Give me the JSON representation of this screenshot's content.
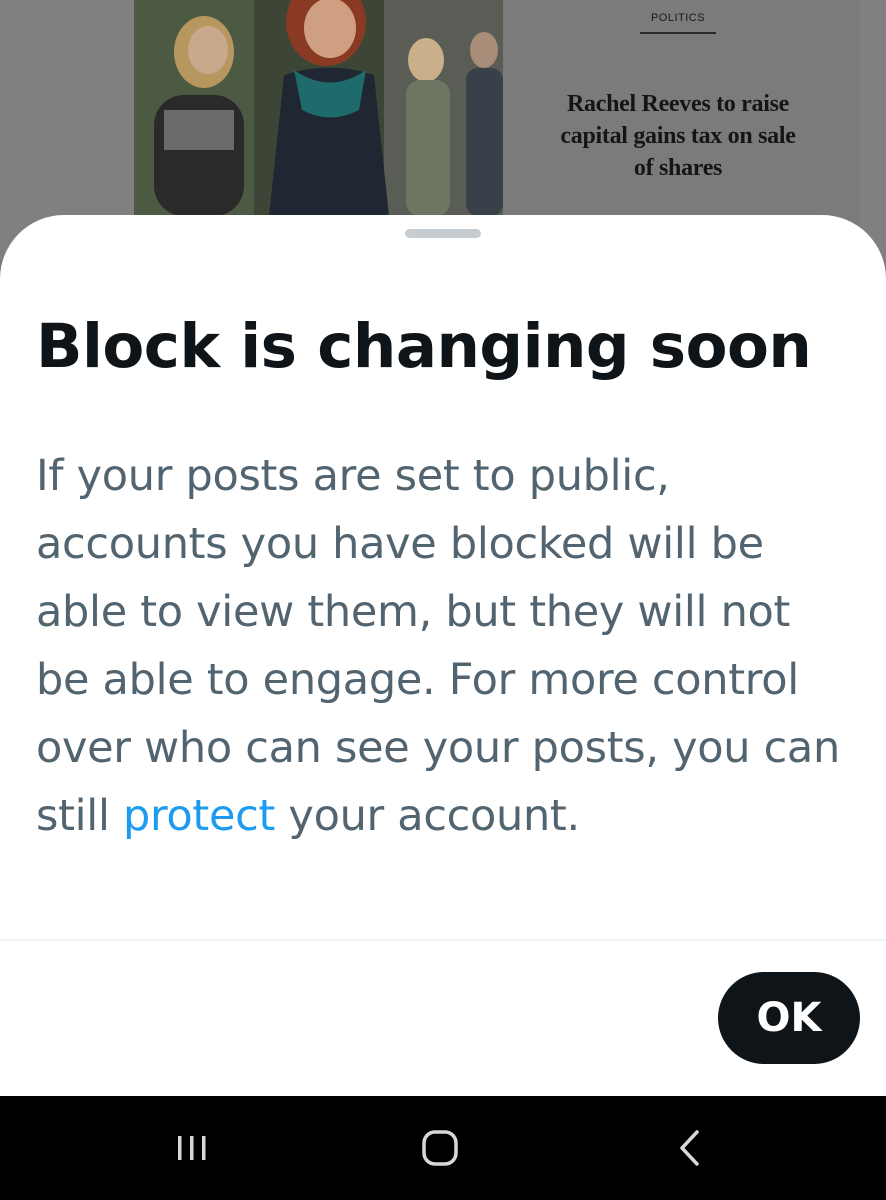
{
  "background": {
    "section_kicker": "POLITICS",
    "headline": "Rachel Reeves to raise capital gains tax on sale of shares",
    "photo_icon": "news-photo"
  },
  "dialog": {
    "title": "Block is changing soon",
    "body_before_link": "If your posts are set to public, accounts you have blocked will be able to view them, but they will not be able to engage. For more control over who can see your posts, you can still ",
    "link_text": "protect",
    "body_after_link": " your account.",
    "ok_label": "OK"
  },
  "system_nav": {
    "recents_icon": "recent-apps-icon",
    "home_icon": "home-icon",
    "back_icon": "back-chevron-icon"
  },
  "colors": {
    "title": "#0f1419",
    "body": "#536471",
    "link": "#1d9bf0",
    "button_bg": "#0f1419",
    "button_text": "#ffffff"
  }
}
